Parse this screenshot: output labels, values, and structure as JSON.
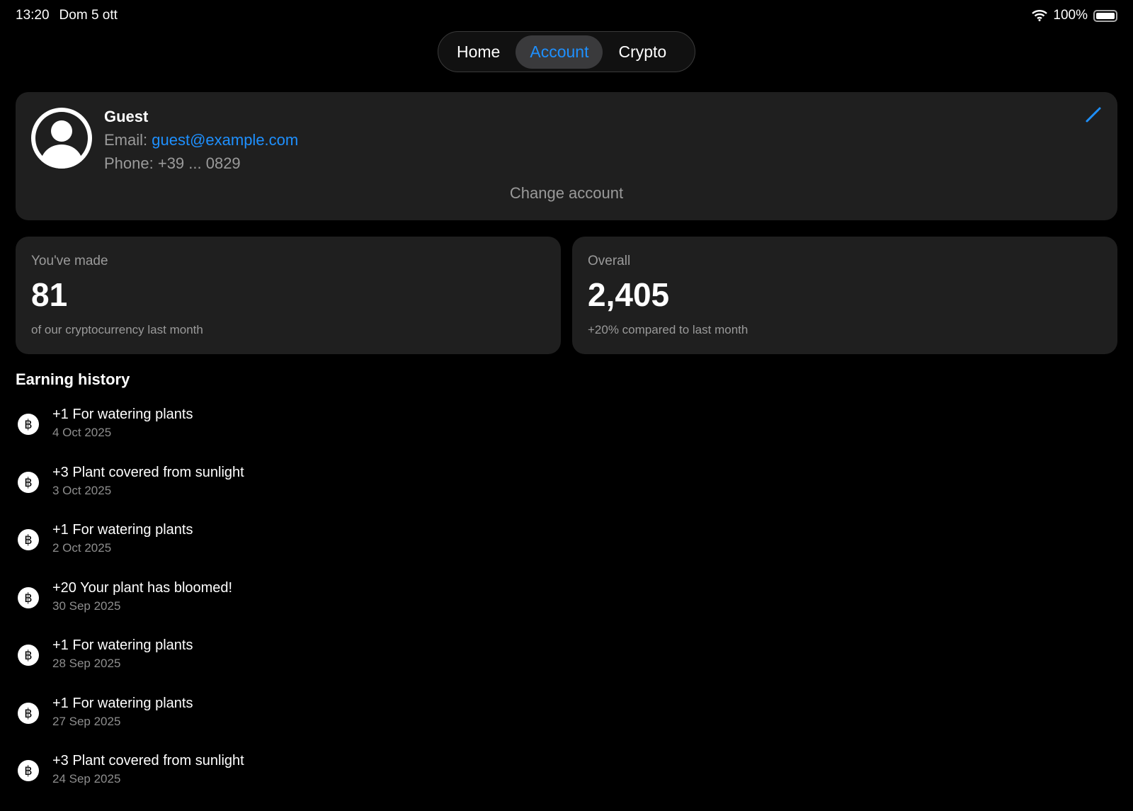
{
  "status": {
    "time": "13:20",
    "date": "Dom 5 ott",
    "battery": "100%"
  },
  "nav": {
    "tabs": [
      "Home",
      "Account",
      "Crypto"
    ],
    "active": "Account"
  },
  "profile": {
    "name": "Guest",
    "email_label": "Email:",
    "email": "guest@example.com",
    "phone": "Phone: +39 ... 0829",
    "change": "Change account"
  },
  "stats": [
    {
      "label": "You've made",
      "value": "81",
      "sub": "of our cryptocurrency last month"
    },
    {
      "label": "Overall",
      "value": "2,405",
      "sub": "+20% compared to last month"
    }
  ],
  "history": {
    "title": "Earning history",
    "items": [
      {
        "text": "+1 For watering plants",
        "date": "4 Oct 2025"
      },
      {
        "text": "+3 Plant covered from sunlight",
        "date": "3 Oct 2025"
      },
      {
        "text": "+1 For watering plants",
        "date": "2 Oct 2025"
      },
      {
        "text": "+20 Your plant has bloomed!",
        "date": "30 Sep 2025"
      },
      {
        "text": "+1 For watering plants",
        "date": "28 Sep 2025"
      },
      {
        "text": "+1 For watering plants",
        "date": "27 Sep 2025"
      },
      {
        "text": "+3 Plant covered from sunlight",
        "date": "24 Sep 2025"
      }
    ]
  },
  "coin_glyph": "฿"
}
